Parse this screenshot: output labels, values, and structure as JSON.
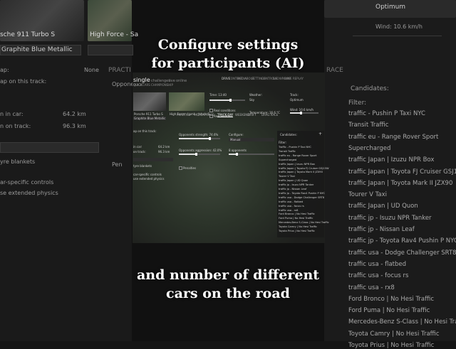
{
  "captions": {
    "top_line1": "Configure settings",
    "top_line2": "for participants (AI)",
    "bottom_line1": "and number of different",
    "bottom_line2": "cars on the road"
  },
  "background": {
    "left": {
      "car_name": "sche 911 Turbo S",
      "car_skin": "Graphite Blue Metallic",
      "track_name": "High Force - Sa",
      "label_ap": "ap:",
      "label_on_track": "ap on this track:",
      "label_in_car": "n in car:",
      "value_in_car": "64.2 km",
      "label_on_track_dist": "n on track:",
      "value_on_track_dist": "96.3 km",
      "label_blankets": "yre blankets",
      "label_specific": "ar-specific controls",
      "label_physics": "se extended physics",
      "label_none": "None",
      "label_practice": "PRACTI",
      "label_opponent": "Opponen",
      "label_penalties": "Pen"
    },
    "right": {
      "optimum": "Optimum",
      "wind": "Wind: 10.6 km/h",
      "race": "RACE",
      "candidates_label": "Candidates:",
      "filter_label": "Filter:",
      "candidates": [
        "traffic - Pushin P Taxi NYC",
        "Transit Traffic",
        "traffic eu - Range Rover Sport",
        "Supercharged",
        "traffic Japan | Izuzu NPR Box",
        "traffic Japan | Toyota FJ Cruiser GSJ15W",
        "traffic Japan | Toyota Mark II JZX90",
        "Tourer V Taxi",
        "traffic Japan | UD Quon",
        "traffic jp - Isuzu NPR Tanker",
        "traffic jp - Nissan Leaf",
        "traffic jp - Toyota Rav4 Pushin P NYC",
        "traffic usa - Dodge Challenger SRT8",
        "traffic usa - flatbed",
        "traffic usa - focus rs",
        "traffic usa - rx8",
        "Ford Bronco | No Hesi Traffic",
        "Ford Puma | No Hesi Traffic",
        "Mercedes-Benz S-Class | No Hesi Traffic",
        "Toyota Camry | No Hesi Traffic",
        "Toyota Prius | No Hesi Traffic"
      ]
    }
  },
  "screen": {
    "header": {
      "title": "single",
      "tabs": [
        "challenges",
        "live",
        "online"
      ],
      "sub_tabs": [
        "QUICK",
        "CARS",
        "CHAMPIONSHIP"
      ],
      "top_menu": [
        "DRIVE",
        "CONTENT",
        "MEDIA",
        "ABOUT",
        "SETTINGS",
        "CONTROLS",
        "SHOWROOM",
        "RACE",
        "REPLAY"
      ]
    },
    "car": {
      "name": "Porsche 911 Turbo S",
      "skin": "Graphite Blue Metallic"
    },
    "track": {
      "name": "High Force - Lamb - John's S..."
    },
    "conditions": {
      "time_label": "Time: 13:40",
      "weather_label": "Weather:",
      "weather_value": "Sky",
      "track_label": "Track:",
      "track_value": "Optimum",
      "real_conditions": "Real conditions",
      "real_weather": "Real weather",
      "temperature": "Temperature: 16.6 °C",
      "wind": "Wind: 10.6 km/h"
    },
    "left_info": {
      "none": "None",
      "on_track": "ap on this track:",
      "in_car": "in car:",
      "in_car_value": "64.2 km",
      "on_track_dist": "on track:",
      "on_track_dist_value": "96.3 km",
      "tyre_blankets": "tyre blankets",
      "specific_controls": "car-specific controls",
      "extended_physics": "use extended physics"
    },
    "mode_tabs": [
      "PRACTICE",
      "HOTLAP",
      "RACE",
      "TRACK DAY",
      "WEEKEND",
      "DRIFT",
      "DRAG RACE"
    ],
    "active_mode": "TRACK DAY",
    "opponents": {
      "strength_label": "Opponents strength: 74.6%",
      "aggression_label": "Opponents aggression: 42.0%",
      "strength_fraction": 0.746,
      "aggression_fraction": 0.42,
      "config_label": "Configure:",
      "config_value": "Manual",
      "count_label": "8 opponents",
      "penalties": "Penalties"
    },
    "candidates": {
      "title": "Candidates:",
      "filter": "Filter:",
      "items": [
        "Traffic - Pushin P Taxi NYC",
        "Transit Traffic",
        "traffic eu - Range Rover Sport",
        "Supercharged",
        "traffic Japan | Izuzu NPR Box",
        "traffic Japan | Toyota FJ Cruiser GSJ15W",
        "traffic Japan | Toyota Mark II JZX90",
        "Tourer V Taxi",
        "traffic Japan | UD Quon",
        "traffic jp - Isuzu NPR Tanker",
        "traffic jp - Nissan Leaf",
        "traffic jp - Toyota Rav4 Pushin P NYC",
        "traffic usa - Dodge Challenger SRT8",
        "traffic usa - flatbed",
        "traffic usa - focus rs",
        "traffic usa - rx8",
        "Ford Bronco | No Hesi Traffic",
        "Ford Puma | No Hesi Traffic",
        "Mercedes-Benz S-Class | No Hesi Traffic",
        "Toyota Camry | No Hesi Traffic",
        "Toyota Prius | No Hesi Traffic"
      ]
    }
  }
}
